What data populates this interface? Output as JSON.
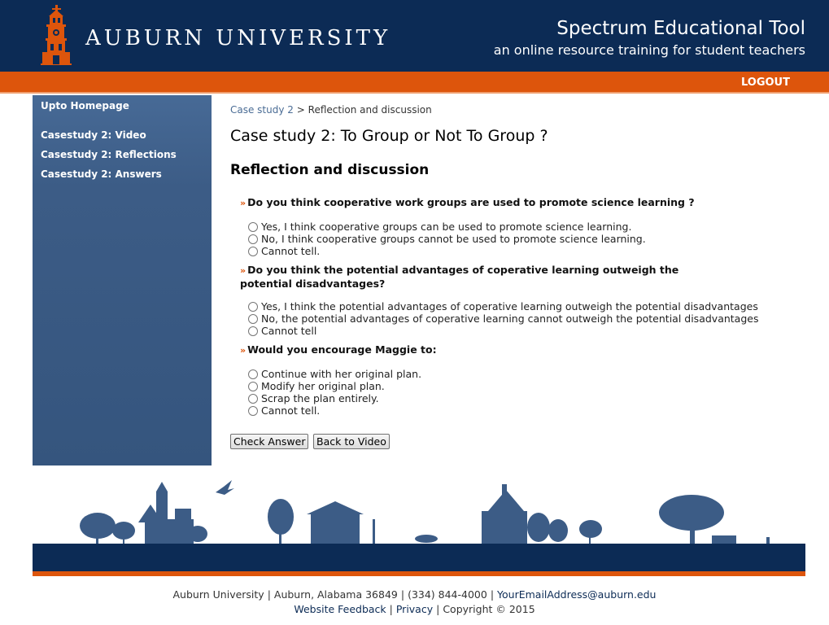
{
  "header": {
    "university": "AUBURN UNIVERSITY",
    "title": "Spectrum Educational Tool",
    "subtitle": "an online resource training for student teachers",
    "logout": "LOGOUT"
  },
  "sidebar": {
    "items": [
      {
        "label": "Upto Homepage"
      },
      {
        "label": "Casestudy 2: Video"
      },
      {
        "label": "Casestudy 2: Reflections"
      },
      {
        "label": "Casestudy 2: Answers"
      }
    ]
  },
  "breadcrumb": {
    "link": "Case study 2",
    "separator": ">",
    "current": "Reflection and discussion"
  },
  "page_title": "Case study 2: To Group or Not To Group ?",
  "section_title": "Reflection and discussion",
  "questions": [
    {
      "bullet": "»",
      "text": "Do you think cooperative work groups are used to promote science learning ?",
      "options": [
        "Yes, I think cooperative groups can be used to promote science learning.",
        "No, I think cooperative groups cannot be used to promote science learning.",
        "Cannot tell."
      ]
    },
    {
      "bullet": "»",
      "text": "Do you think the potential advantages of coperative learning outweigh the potential disadvantages?",
      "options": [
        "Yes, I think the potential advantages of coperative learning outweigh the potential disadvantages",
        "No, the potential advantages of coperative learning cannot outweigh the potential disadvantages",
        "Cannot tell"
      ]
    },
    {
      "bullet": "»",
      "text": "Would you encourage Maggie to:",
      "options": [
        "Continue with her original plan.",
        "Modify her original plan.",
        "Scrap the plan entirely.",
        "Cannot tell."
      ]
    }
  ],
  "buttons": {
    "check": "Check Answer",
    "back": "Back to Video"
  },
  "footer": {
    "line1": {
      "org": "Auburn University",
      "address": "Auburn, Alabama 36849",
      "phone": "(334) 844-4000",
      "email": "YourEmailAddress@auburn.edu",
      "sep": "|"
    },
    "line2": {
      "feedback": "Website Feedback",
      "privacy": "Privacy",
      "copyright": "Copyright © 2015",
      "sep": "|"
    }
  },
  "colors": {
    "navy": "#0c2b55",
    "orange": "#dd550c",
    "sidebar": "#3c5c86"
  }
}
